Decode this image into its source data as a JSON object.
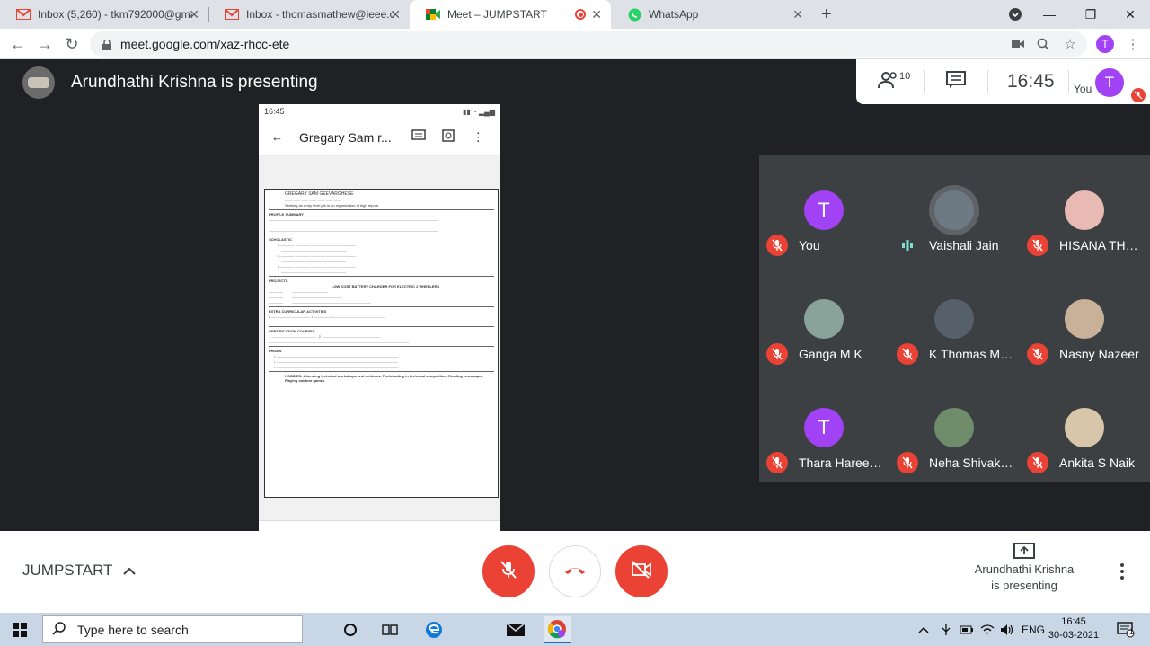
{
  "browser": {
    "tabs": [
      {
        "title": "Inbox (5,260) - tkm792000@gma",
        "icon": "gmail-icon"
      },
      {
        "title": "Inbox - thomasmathew@ieee.org",
        "icon": "gmail-icon"
      },
      {
        "title": "Meet – JUMPSTART",
        "icon": "meet-icon",
        "active": true
      },
      {
        "title": "WhatsApp",
        "icon": "whatsapp-icon"
      }
    ],
    "new_tab": "+",
    "url": "meet.google.com/xaz-rhcc-ete",
    "profile_initial": "T"
  },
  "meet": {
    "presenting_banner": "Arundhathi Krishna is presenting",
    "participant_count": "10",
    "time": "16:45",
    "you_label": "You",
    "you_initial": "T",
    "meeting_name": "JUMPSTART",
    "present_status_line1": "Arundhathi Krishna",
    "present_status_line2": "is presenting",
    "colors": {
      "mic_off": "#ea4335",
      "avatar_purple": "#a142f4",
      "tile_bg": "#3c4043"
    },
    "participants": [
      {
        "name": "You",
        "initial": "T",
        "muted": true
      },
      {
        "name": "Vaishali Jain",
        "initial": "",
        "muted": false
      },
      {
        "name": "HISANA TH…",
        "initial": "",
        "muted": true
      },
      {
        "name": "Ganga M K",
        "initial": "",
        "muted": true
      },
      {
        "name": "K Thomas M…",
        "initial": "",
        "muted": true
      },
      {
        "name": "Nasny Nazeer",
        "initial": "",
        "muted": true
      },
      {
        "name": "Thara Haree…",
        "initial": "T",
        "muted": true
      },
      {
        "name": "Neha Shivak…",
        "initial": "",
        "muted": true
      },
      {
        "name": "Ankita S Naik",
        "initial": "",
        "muted": true
      }
    ]
  },
  "shared_screen": {
    "status_time": "16:45",
    "doc_title": "Gregary Sam r...",
    "resume": {
      "name": "GREGARY SAM GEEVARGHESE",
      "objective": "Seeking an entry level job in an organization of high repute.",
      "headings": [
        "PROFILE SUMMARY",
        "SCHOLASTIC",
        "PROJECTS",
        "EXTRA CURRICULAR ACTIVITIES",
        "CERTIFICATION COURSES",
        "PRIZES"
      ],
      "project_title": "LOW COST BATTERY CHARGER FOR ELECTRIC 2 WHEELERS",
      "hobbies": "HOBBIES: Attending technical workshops and webinars, Participating in technical competition, Reading newspaper, Playing outdoor games"
    }
  },
  "taskbar": {
    "search_placeholder": "Type here to search",
    "lang": "ENG",
    "time": "16:45",
    "date": "30-03-2021",
    "notification_count": "1"
  }
}
